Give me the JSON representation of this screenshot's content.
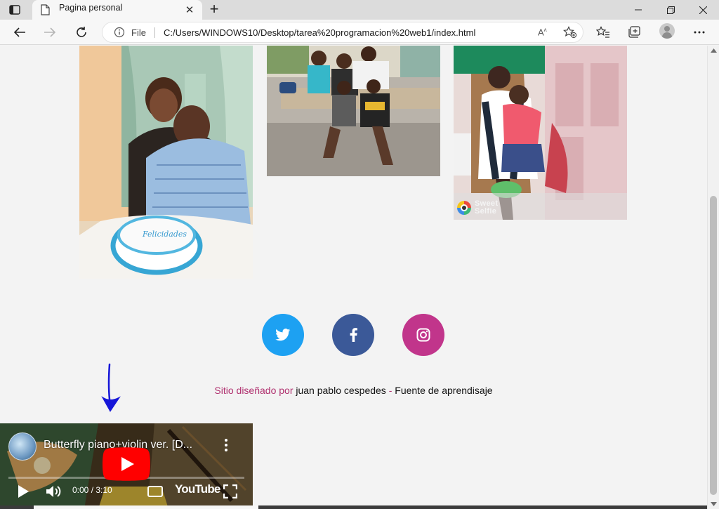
{
  "browser": {
    "tab": {
      "title": "Pagina personal"
    },
    "address": {
      "scheme_label": "File",
      "url": "C:/Users/WINDOWS10/Desktop/tarea%20programacion%20web1/index.html"
    }
  },
  "gallery": {
    "photos": [
      {
        "name": "Couple with birthday cake",
        "cake_text": "Felicidades"
      },
      {
        "name": "Family group on wooden deck"
      },
      {
        "name": "Grandmother with child on porch",
        "watermark": "Sweet Selfie"
      }
    ]
  },
  "social": {
    "items": [
      {
        "name": "twitter",
        "color": "#1da1f2"
      },
      {
        "name": "facebook",
        "color": "#3b5998"
      },
      {
        "name": "instagram",
        "color": "#c1358b"
      }
    ]
  },
  "footer": {
    "prefix": "Sitio diseñado por",
    "author": "juan pablo cespedes",
    "separator": "-",
    "resource": "Fuente de aprendisaje",
    "accent_color": "#b0316f"
  },
  "video": {
    "title": "Butterfly piano+violin ver. [D...",
    "time": "0:00 / 3:10",
    "brand": "YouTube",
    "cc_label": "CC"
  }
}
